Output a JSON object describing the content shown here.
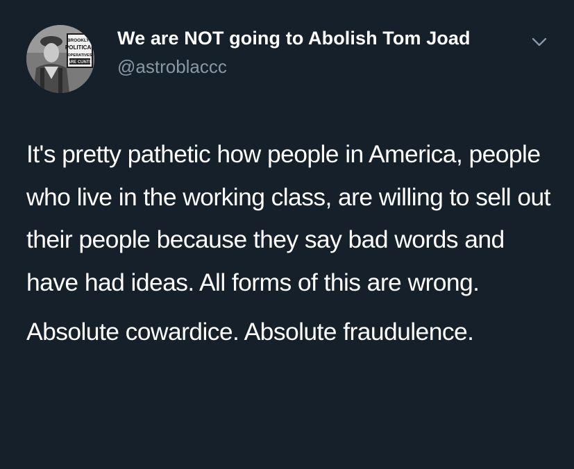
{
  "tweet": {
    "author": {
      "display_name": "We are NOT going to Abolish Tom Joad",
      "handle": "@astroblaccc",
      "avatar_sign": [
        "BROOKLYN",
        "POLITICAL",
        "OPERATIVES",
        "ARE CUNTS"
      ]
    },
    "menu_icon": "chevron-down-icon",
    "paragraphs": [
      "It's pretty pathetic how people in America, people who live in the working class, are willing to sell out their people because they say bad words and have had ideas. All forms of this are wrong.",
      "Absolute cowardice. Absolute fraudulence."
    ]
  },
  "colors": {
    "background": "#15202b",
    "text": "#ffffff",
    "secondary_text": "#8899a6"
  }
}
